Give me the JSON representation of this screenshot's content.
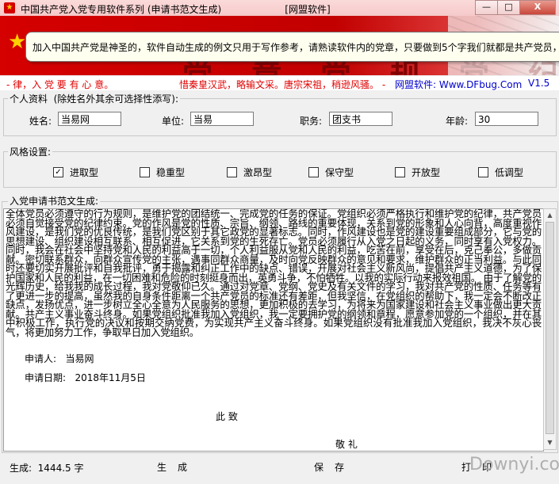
{
  "window": {
    "title": "中国共产党入党专用软件系列 (申请书范文生成)                     [网盟软件]",
    "buttons": [
      "—",
      "□",
      "X"
    ]
  },
  "banner": {
    "big_text": "党 章 党 规 党 纪",
    "tooltip": "加入中国共产党是神圣的，软件自动生成的例文只用于写作参考，请熟读软件内的党章，只要做到5个字我们就都是共产党员，"
  },
  "slogan": {
    "left": "- 律，入 党 要 有 心 意。",
    "middle": "惜秦皇汉武，略输文采。唐宗宋祖，稍逊风骚。 -",
    "site": "网盟软件: Www.DFbug.Com",
    "version": "V1.5"
  },
  "personal": {
    "legend": "个人资料  (除姓名外其余可选择性添写):",
    "name_label": "姓名:",
    "name_value": "当易网",
    "unit_label": "单位:",
    "unit_value": "当易",
    "duty_label": "职务:",
    "duty_value": "团支书",
    "age_label": "年龄:",
    "age_value": "30"
  },
  "style": {
    "legend": "风格设置:",
    "options": [
      {
        "label": "进取型",
        "checked": true
      },
      {
        "label": "稳重型",
        "checked": false
      },
      {
        "label": "激昂型",
        "checked": false
      },
      {
        "label": "保守型",
        "checked": false
      },
      {
        "label": "开放型",
        "checked": false
      },
      {
        "label": "低调型",
        "checked": false
      }
    ]
  },
  "generated": {
    "legend": "入党申请书范文生成:",
    "paragraph": "全体党员必须遵守的行为规则，是维护党的团结统一、完成党的任务的保证。党组织必须严格执行和维护党的纪律，共产党员必须自觉接受党的纪律约束。党的作风是党的性质、宗旨、纲领、路线的重要体现，关系到党的形象和人心向背，高度重视作风建设，是我们党的优良传统，是我们党区别于其它政党的显著标志。同时，作风建设也是党的建设重要组成部分，它与党的思想建设、组织建设相互联系、相互促进，它关系到党的生死存亡。党员必须履行从入党之日起的义务，同时享有入党权力。    同时，我会在社会中坚持党和人民的利益高于一切，个人利益服从党和人民的利益，吃苦在前，享受在后，克己奉公，多做贡献。密切联系群众，向群众宣传党的主张，遇事同群众商量，及时向党反映群众的意见和要求，维护群众的正当利益。与此同时还要切实开展批评和自我批评，勇于揭露和纠正工作中的缺点、错误，开展对社会主义新风尚，提倡共产主义道德，为了保护国家和人民的利益，在一切困难和危险的时刻挺身而出，英勇斗争，不怕牺牲。以我的实际行动来报效祖国。    由于了解党的光辉历史，给我我的成长过程，我对党敬仰已久。通过对党章、党纲、党史及有关文件的学习，我对共产党的性质、任务等有了更进一步的提高，虽然我的自身条件距离一个共产党员的标准还有差距，但我坚信，在党组织的帮助下，我一定会不断改正缺点，发扬优点，进一步树立全心全意为人民服务的思想，更加积极的去学习，为将来为国家建设和社会主义事业做出更大贡献。共产主义事业奋斗终身。如果党组织批准我加入党组织，我一定要拥护党的纲领和章程，愿意参加党的一个组织，并在其中积极工作，执行党的决议和按期交纳党费，为实现共产主义奋斗终身。如果党组织没有批准我加入党组织，我决不灰心丧气，将更加努力工作，争取早日加入党组织。",
    "applicant": "申请人:   当易网",
    "date": "申请日期:   2018年11月5日",
    "salute1": "此 致",
    "salute2": "敬 礼"
  },
  "status": {
    "generated_text": "生成:  1444.5 字",
    "btn_generate": "生成",
    "btn_save": "保存",
    "btn_print": "打印"
  },
  "watermark": "Downyi.com"
}
